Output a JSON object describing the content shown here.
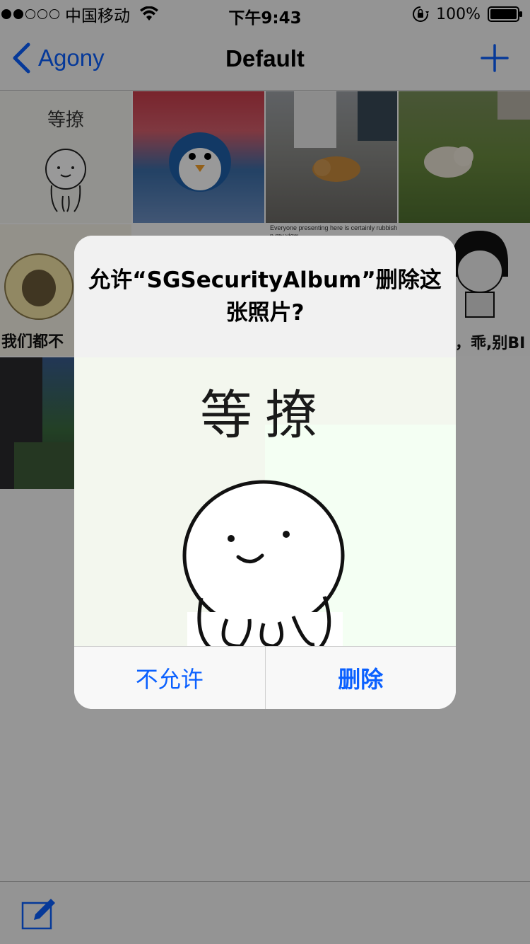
{
  "status_bar": {
    "carrier": "中国移动",
    "time": "下午9:43",
    "battery": "100%",
    "signal_filled": 2,
    "signal_total": 5
  },
  "nav": {
    "back_label": "Agony",
    "title": "Default"
  },
  "grid": {
    "sticker_caption": "等撩",
    "meme1_caption": "我们都不",
    "meme2_caption": "，乖,别BI",
    "doc_text": "Everyone presenting here is certainly rubbish I\nn my view."
  },
  "alert": {
    "title": "允许“SGSecurityAlbum”删除这张照片?",
    "preview_caption": "等撩",
    "buttons": {
      "deny": "不允许",
      "delete": "删除"
    }
  },
  "colors": {
    "accent": "#0a60ff",
    "dim": "rgba(0,0,0,0.4)"
  }
}
